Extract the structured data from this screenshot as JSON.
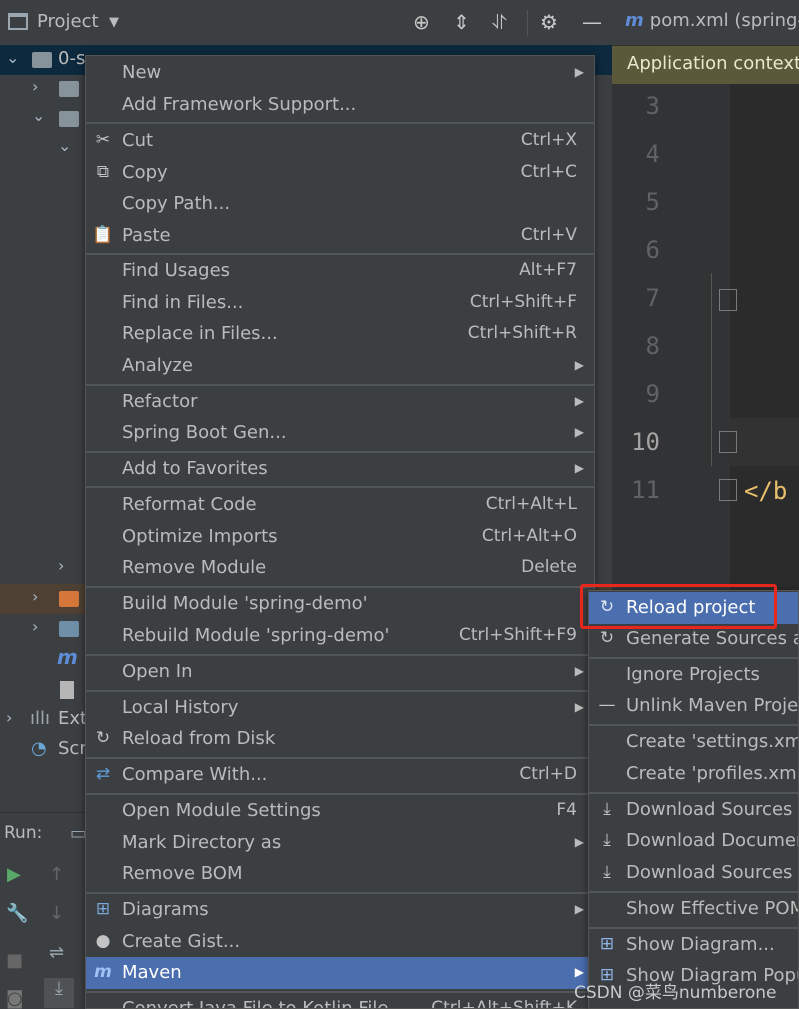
{
  "project_panel": {
    "title": "Project",
    "tree": {
      "root_label": "0-s",
      "ext_label": "Ext",
      "scr_label": "Scr"
    },
    "run_label": "Run:"
  },
  "editor": {
    "tab_label": "pom.xml (spring-",
    "context_banner": "Application context",
    "line_numbers": [
      "3",
      "4",
      "5",
      "6",
      "7",
      "8",
      "9",
      "10",
      "11"
    ],
    "code_text": "</b"
  },
  "context_menu": {
    "items": [
      {
        "label": "New",
        "submenu": true
      },
      {
        "label": "Add Framework Support..."
      },
      {
        "label": "Cut",
        "shortcut": "Ctrl+X",
        "icon": "scissors-icon"
      },
      {
        "label": "Copy",
        "shortcut": "Ctrl+C",
        "icon": "copy-icon"
      },
      {
        "label": "Copy Path..."
      },
      {
        "label": "Paste",
        "shortcut": "Ctrl+V",
        "icon": "paste-icon"
      },
      {
        "label": "Find Usages",
        "shortcut": "Alt+F7"
      },
      {
        "label": "Find in Files...",
        "shortcut": "Ctrl+Shift+F"
      },
      {
        "label": "Replace in Files...",
        "shortcut": "Ctrl+Shift+R"
      },
      {
        "label": "Analyze",
        "submenu": true
      },
      {
        "label": "Refactor",
        "submenu": true
      },
      {
        "label": "Spring Boot Gen...",
        "submenu": true
      },
      {
        "label": "Add to Favorites",
        "submenu": true
      },
      {
        "label": "Reformat Code",
        "shortcut": "Ctrl+Alt+L"
      },
      {
        "label": "Optimize Imports",
        "shortcut": "Ctrl+Alt+O"
      },
      {
        "label": "Remove Module",
        "shortcut": "Delete"
      },
      {
        "label": "Build Module 'spring-demo'"
      },
      {
        "label": "Rebuild Module 'spring-demo'",
        "shortcut": "Ctrl+Shift+F9"
      },
      {
        "label": "Open In",
        "submenu": true
      },
      {
        "label": "Local History",
        "submenu": true
      },
      {
        "label": "Reload from Disk",
        "icon": "reload-icon"
      },
      {
        "label": "Compare With...",
        "shortcut": "Ctrl+D",
        "icon": "compare-icon"
      },
      {
        "label": "Open Module Settings",
        "shortcut": "F4"
      },
      {
        "label": "Mark Directory as",
        "submenu": true
      },
      {
        "label": "Remove BOM"
      },
      {
        "label": "Diagrams",
        "submenu": true,
        "icon": "diagram-icon"
      },
      {
        "label": "Create Gist...",
        "icon": "github-icon"
      },
      {
        "label": "Maven",
        "submenu": true,
        "icon": "maven-icon",
        "active": true
      },
      {
        "label": "Convert Java File to Kotlin File",
        "shortcut": "Ctrl+Alt+Shift+K"
      }
    ]
  },
  "maven_submenu": {
    "items": [
      {
        "label": "Reload project",
        "icon": "reload-icon",
        "active": true
      },
      {
        "label": "Generate Sources an"
      },
      {
        "label": "Ignore Projects"
      },
      {
        "label": "Unlink Maven Projec"
      },
      {
        "label": "Create 'settings.xml'"
      },
      {
        "label": "Create 'profiles.xml'"
      },
      {
        "label": "Download Sources"
      },
      {
        "label": "Download Documen"
      },
      {
        "label": "Download Sources a"
      },
      {
        "label": "Show Effective POM"
      },
      {
        "label": "Show Diagram..."
      },
      {
        "label": "Show Diagram Popu"
      }
    ]
  },
  "watermark": "CSDN @菜鸟numberone",
  "colors": {
    "menu_bg": "#3c3f41",
    "active_item": "#4b6eaf",
    "highlight_box": "#e8261e",
    "editor_bg": "#2b2b2b"
  }
}
